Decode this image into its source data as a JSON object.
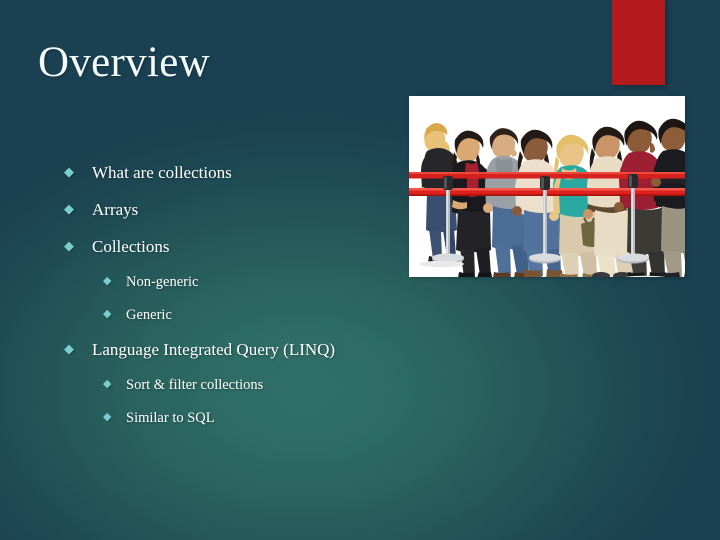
{
  "slide": {
    "title": "Overview",
    "accent_red": "#b4191b",
    "bullet_diamond_color": "#79cfcd",
    "text_color": "#ffffff",
    "background_dark": "#1b4051",
    "background_light": "#317069",
    "bullet_glyph": "◆",
    "bullets": [
      {
        "level": 1,
        "text": "What are collections"
      },
      {
        "level": 1,
        "text": "Arrays"
      },
      {
        "level": 1,
        "text": "Collections"
      },
      {
        "level": 2,
        "text": "Non-generic"
      },
      {
        "level": 2,
        "text": "Generic"
      },
      {
        "level": 1,
        "text": "Language Integrated Query (LINQ)"
      },
      {
        "level": 2,
        "text": "Sort & filter collections"
      },
      {
        "level": 2,
        "text": "Similar to SQL"
      }
    ],
    "photo": {
      "alt": "Line of people queueing behind red velvet rope barriers"
    }
  }
}
